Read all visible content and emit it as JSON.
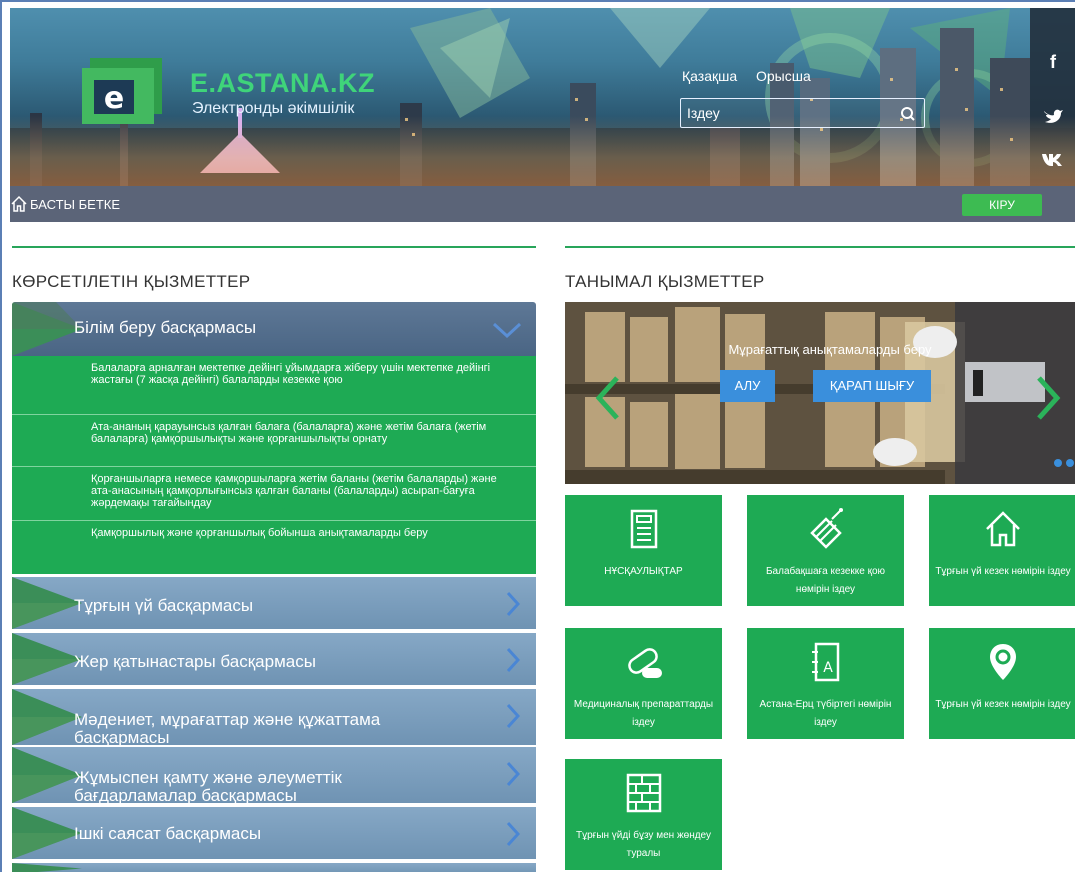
{
  "header": {
    "brand_title": "E.ASTANA.KZ",
    "brand_subtitle": "Электронды әкімшілік",
    "logo_letter": "e",
    "lang_kazakh": "Қазақша",
    "lang_russian": "Орысша",
    "search_placeholder": "Іздеу",
    "social": [
      "facebook-icon",
      "twitter-icon",
      "vk-icon"
    ]
  },
  "navbar": {
    "home_label": "БАСТЫ БЕТКЕ",
    "login_label": "КІРУ"
  },
  "left": {
    "section_title": "КӨРСЕТІЛЕТІН ҚЫЗМЕТТЕР",
    "open_department": "Білім беру басқармасы",
    "services": [
      "Балаларға арналған мектепке дейінгі ұйымдарға жіберу үшін мектепке дейінгі жастағы (7 жасқа дейінгі) балаларды кезекке қою",
      "Ата-ананың қарауынсыз қалған балаға (балаларға) және жетім балаға (жетім балаларға) қамқоршылықты және қорғаншылықты орнату",
      "Қорғаншыларға немесе қамқоршыларға жетім баланы (жетім балаларды) және ата-анасының қамқорлығынсыз қалған баланы (балаларды) асырап-бағуға жәрдемақы тағайындау",
      "Қамқоршылық және қорғаншылық бойынша анықтамаларды беру"
    ],
    "departments": [
      "Тұрғын үй басқармасы",
      "Жер қатынастары басқармасы",
      "Мәдениет, мұрағаттар және құжаттама басқармасы",
      "Жұмыспен қамту және әлеуметтік бағдарламалар басқармасы",
      "Ішкі саясат басқармасы"
    ]
  },
  "right": {
    "section_title": "ТАНЫМАЛ ҚЫЗМЕТТЕР",
    "slider_caption": "Мұрағаттық анықтамаларды беру",
    "slider_btn_get": "АЛУ",
    "slider_btn_view": "ҚАРАП ШЫҒУ",
    "tiles": [
      {
        "label": "НҰСҚАУЛЫҚТАР",
        "icon": "instruction-book-icon"
      },
      {
        "label": "Балабақшаға кезекке қою нөмірін іздеу",
        "icon": "spinning-top-icon"
      },
      {
        "label": "Тұрғын үй кезек нөмірін іздеу",
        "icon": "house-icon"
      },
      {
        "label": "Медициналық препараттарды іздеу",
        "icon": "pill-icon"
      },
      {
        "label": "Астана-Ерц түбіртегі нөмірін іздеу",
        "icon": "address-book-icon"
      },
      {
        "label": "Тұрғын үй кезек нөмірін іздеу",
        "icon": "location-pin-icon"
      },
      {
        "label": "Тұрғын үйді бұзу мен жөндеу туралы",
        "icon": "brick-wall-icon"
      }
    ]
  },
  "colors": {
    "green": "#1eaa54",
    "navbar": "#5b6478",
    "accordion_blue": "#7a9cbc",
    "accent_blue": "#3a8fdc"
  }
}
